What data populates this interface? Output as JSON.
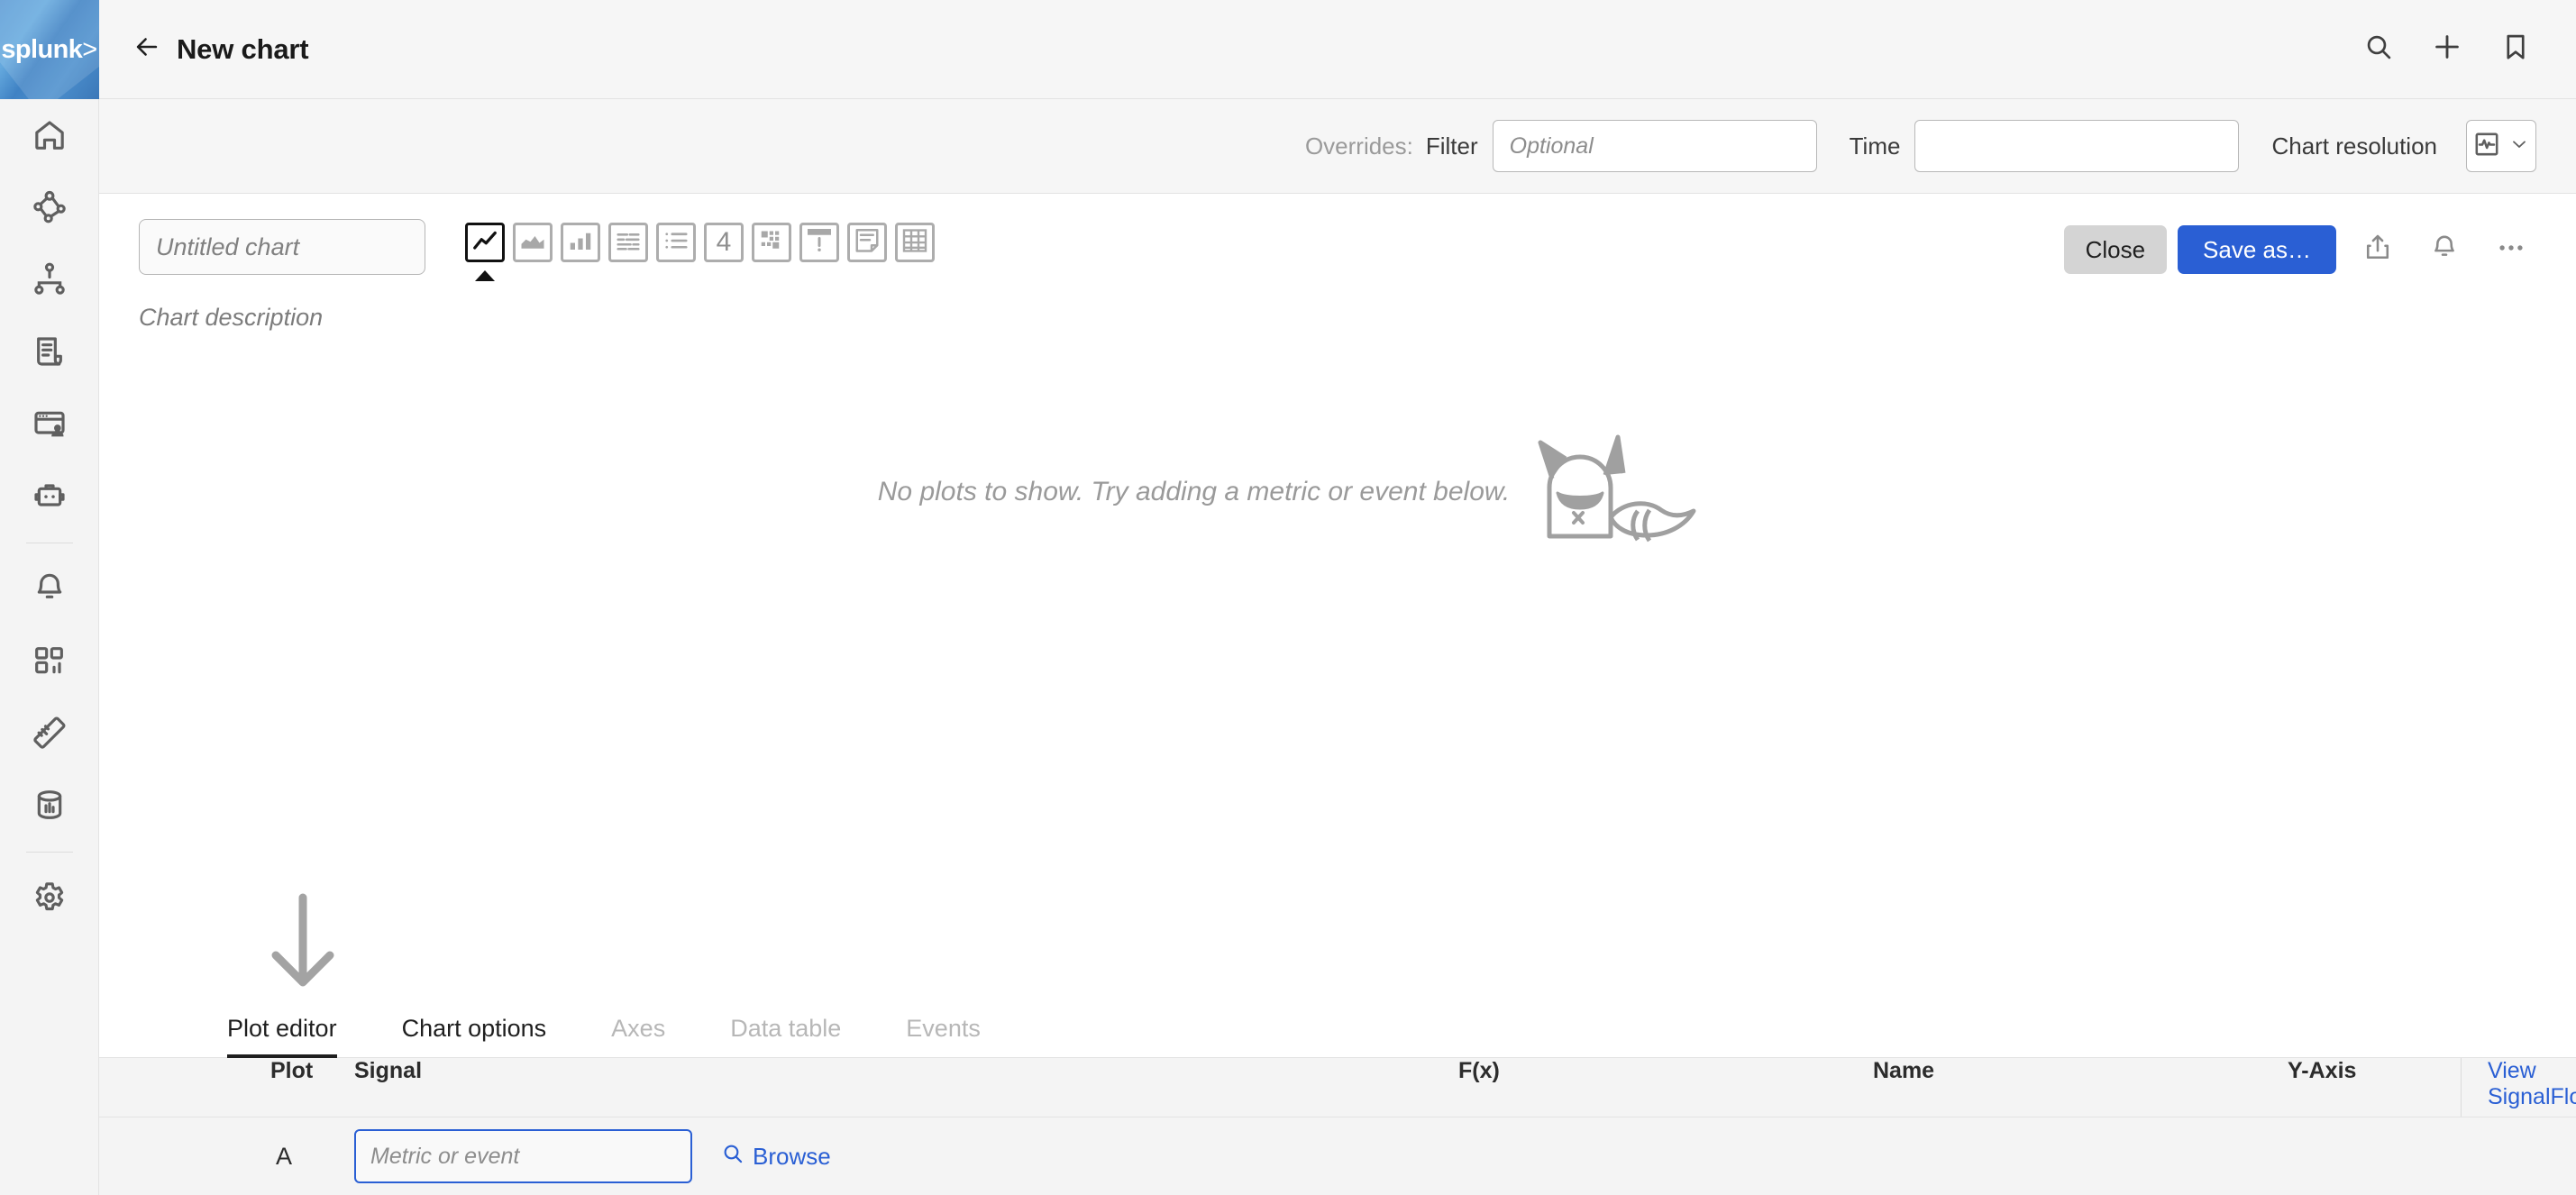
{
  "brand": {
    "logo_text": "splunk",
    "logo_suffix": ">",
    "accent_blue": "#2a5fd4",
    "logo_blue": "#4b8fcd"
  },
  "sidebar": {
    "items": [
      {
        "name": "home",
        "icon": "home-icon"
      },
      {
        "name": "apm",
        "icon": "service-map-icon"
      },
      {
        "name": "infrastructure",
        "icon": "hierarchy-icon"
      },
      {
        "name": "log-observer",
        "icon": "log-document-icon"
      },
      {
        "name": "rum",
        "icon": "browser-user-icon"
      },
      {
        "name": "synthetics",
        "icon": "robot-icon"
      },
      {
        "name": "alerts",
        "icon": "bell-icon"
      },
      {
        "name": "dashboards",
        "icon": "dashboard-grid-icon"
      },
      {
        "name": "metrics",
        "icon": "ruler-icon"
      },
      {
        "name": "data-management",
        "icon": "database-icon"
      },
      {
        "name": "settings",
        "icon": "gear-icon"
      }
    ]
  },
  "header": {
    "title": "New chart",
    "back_icon": "back-arrow-icon",
    "actions": [
      {
        "name": "search",
        "icon": "search-icon"
      },
      {
        "name": "add",
        "icon": "plus-icon"
      },
      {
        "name": "bookmark",
        "icon": "bookmark-icon"
      }
    ]
  },
  "overrides": {
    "label": "Overrides:",
    "filter_label": "Filter",
    "filter_value": "",
    "filter_placeholder": "Optional",
    "time_label": "Time",
    "time_value": "",
    "time_placeholder": "",
    "resolution_label": "Chart resolution",
    "resolution_icon": "pulse-square-icon",
    "resolution_caret": "chevron-down-icon"
  },
  "chart": {
    "title_value": "",
    "title_placeholder": "Untitled chart",
    "description": "Chart description",
    "types": [
      {
        "name": "line-chart",
        "label": "Line chart",
        "selected": true
      },
      {
        "name": "area-chart",
        "label": "Area chart",
        "selected": false
      },
      {
        "name": "column-chart",
        "label": "Column chart",
        "selected": false
      },
      {
        "name": "histogram-chart",
        "label": "Histogram",
        "selected": false
      },
      {
        "name": "list-chart",
        "label": "List",
        "selected": false
      },
      {
        "name": "single-value-chart",
        "label": "Single value",
        "selected": false
      },
      {
        "name": "heatmap-chart",
        "label": "Heatmap",
        "selected": false
      },
      {
        "name": "event-feed-chart",
        "label": "Event feed",
        "selected": false
      },
      {
        "name": "text-note-chart",
        "label": "Text note",
        "selected": false
      },
      {
        "name": "table-chart",
        "label": "Table",
        "selected": false
      }
    ],
    "single_value_text": "4",
    "empty_message": "No plots to show. Try adding a metric or event below.",
    "mascot": "splunk-owl-mascot"
  },
  "toolbar": {
    "close_label": "Close",
    "save_label": "Save as…",
    "share_icon": "share-export-icon",
    "alert_icon": "bell-icon",
    "more_icon": "more-horizontal-icon"
  },
  "tabs": [
    {
      "label": "Plot editor",
      "name": "tab-plot-editor",
      "active": true,
      "muted": false
    },
    {
      "label": "Chart options",
      "name": "tab-chart-options",
      "active": false,
      "muted": false
    },
    {
      "label": "Axes",
      "name": "tab-axes",
      "active": false,
      "muted": true
    },
    {
      "label": "Data table",
      "name": "tab-data-table",
      "active": false,
      "muted": true
    },
    {
      "label": "Events",
      "name": "tab-events",
      "active": false,
      "muted": true
    }
  ],
  "plot_table": {
    "columns": {
      "plot": "Plot",
      "signal": "Signal",
      "fx": "F(x)",
      "name": "Name",
      "yaxis": "Y-Axis"
    },
    "view_signalflow": "View SignalFlow",
    "rows": [
      {
        "plot": "A",
        "signal_value": "",
        "signal_placeholder": "Metric or event",
        "browse_label": "Browse",
        "browse_icon": "search-icon",
        "fx": "",
        "name": "",
        "yaxis": ""
      }
    ]
  }
}
